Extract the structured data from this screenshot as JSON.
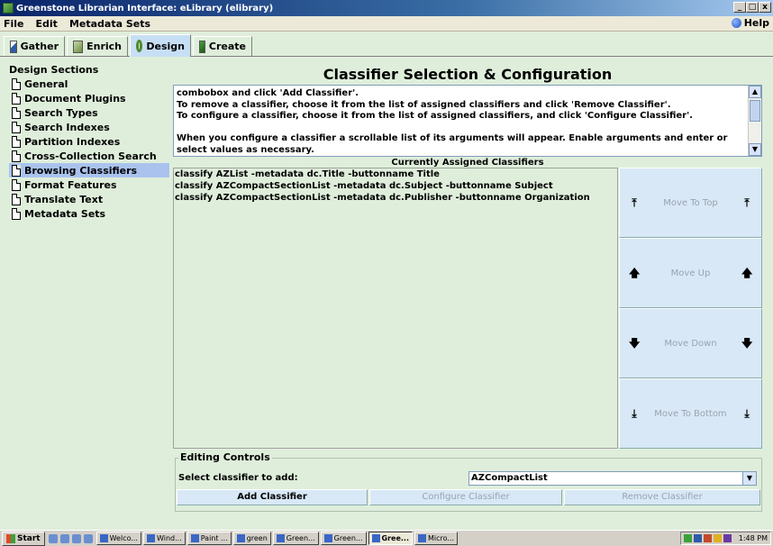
{
  "window": {
    "title": "Greenstone Librarian Interface: eLibrary (elibrary)",
    "controls": [
      "_",
      "□",
      "x"
    ]
  },
  "menu": {
    "items": [
      "File",
      "Edit",
      "Metadata Sets"
    ],
    "help": "Help"
  },
  "tabs": [
    {
      "label": "Gather",
      "icon": "gather-icon"
    },
    {
      "label": "Enrich",
      "icon": "enrich-icon"
    },
    {
      "label": "Design",
      "icon": "design-icon",
      "active": true
    },
    {
      "label": "Create",
      "icon": "create-icon"
    }
  ],
  "sidebar": {
    "heading": "Design Sections",
    "items": [
      {
        "label": "General"
      },
      {
        "label": "Document Plugins"
      },
      {
        "label": "Search Types"
      },
      {
        "label": "Search Indexes"
      },
      {
        "label": "Partition Indexes"
      },
      {
        "label": "Cross-Collection Search"
      },
      {
        "label": "Browsing Classifiers",
        "selected": true
      },
      {
        "label": "Format Features"
      },
      {
        "label": "Translate Text"
      },
      {
        "label": "Metadata Sets"
      }
    ]
  },
  "main": {
    "title": "Classifier Selection & Configuration",
    "help_lines": [
      "combobox and click 'Add Classifier'.",
      "To remove a classifier, choose it from the list of assigned classifiers and click 'Remove Classifier'.",
      "To configure a classifier, choose it from the list of assigned classifiers, and click 'Configure Classifier'.",
      "",
      "When you configure a classifier a scrollable list of its arguments will appear. Enable arguments and enter or",
      "select values as necessary."
    ],
    "assigned_heading": "Currently Assigned Classifiers",
    "assigned": [
      "classify AZList -metadata dc.Title -buttonname Title",
      "classify AZCompactSectionList -metadata dc.Subject -buttonname Subject",
      "classify AZCompactSectionList -metadata dc.Publisher -buttonname Organization"
    ],
    "move_buttons": {
      "top": "Move To Top",
      "up": "Move Up",
      "down": "Move Down",
      "bottom": "Move To Bottom"
    },
    "editing": {
      "legend": "Editing Controls",
      "select_label": "Select classifier to add:",
      "selected_value": "AZCompactList",
      "add": "Add Classifier",
      "configure": "Configure Classifier",
      "remove": "Remove Classifier"
    }
  },
  "taskbar": {
    "start": "Start",
    "tasks": [
      "Welco...",
      "Wind...",
      "Paint ...",
      "green",
      "Green...",
      "Green...",
      "Gree...",
      "Micro..."
    ],
    "active_task_index": 6,
    "clock": "1:48 PM"
  },
  "colors": {
    "panel_bg": "#dfeedb",
    "selected_bg": "#a9c3ee",
    "button_bg": "#d8e8f6",
    "title_gradient_start": "#0a246a"
  }
}
